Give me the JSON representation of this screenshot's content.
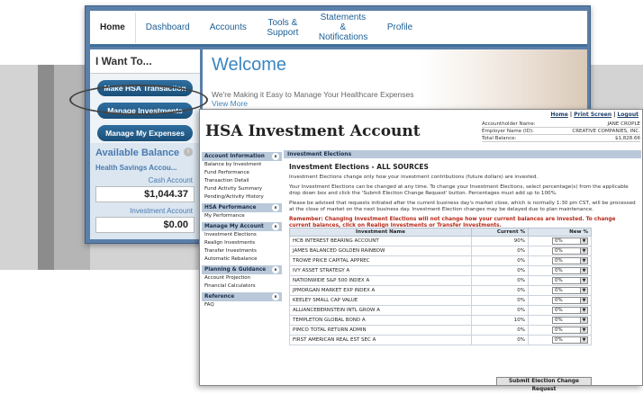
{
  "portal": {
    "nav": [
      "Home",
      "Dashboard",
      "Accounts",
      "Tools & Support",
      "Statements & Notifications",
      "Profile"
    ],
    "iwant": "I Want To...",
    "buttons": [
      "Make HSA Transaction",
      "Manage Investments",
      "Manage My Expenses"
    ],
    "avail_title": "Available Balance",
    "avail_info": "i",
    "acct_name": "Health Savings Accou...",
    "cash_label": "Cash Account",
    "cash_amount": "$1,044.37",
    "inv_label": "Investment Account",
    "inv_amount": "$0.00",
    "welcome": "Welcome",
    "welcome_sub": "We're Making it Easy to Manage Your Healthcare Expenses",
    "view_more": "View More"
  },
  "hsa": {
    "links": [
      "Home",
      "Print Screen",
      "Logout"
    ],
    "title": "HSA Investment Account",
    "holder": [
      {
        "label": "Accountholder Name:",
        "value": "JANE CROPLE"
      },
      {
        "label": "Employer Name (ID):",
        "value": "CREATIVE COMPANIES, INC."
      },
      {
        "label": "Total Balance:",
        "value": "$1,828.66"
      }
    ],
    "sections": [
      {
        "head": "Account Information",
        "items": [
          "Balance by Investment",
          "Fund Performance",
          "Transaction Detail",
          "Fund Activity Summary",
          "Pending/Activity History"
        ]
      },
      {
        "head": "HSA Performance",
        "items": [
          "My Performance"
        ]
      },
      {
        "head": "Manage My Account",
        "items": [
          "Investment Elections",
          "Realign Investments",
          "Transfer Investments",
          "Automatic Rebalance"
        ]
      },
      {
        "head": "Planning & Guidance",
        "items": [
          "Account Projection",
          "Financial Calculators"
        ]
      },
      {
        "head": "Reference",
        "items": [
          "FAQ"
        ]
      }
    ],
    "main_head": "Investment Elections",
    "main_title": "Investment Elections - ALL SOURCES",
    "p1": "Investment Elections change only how your investment contributions (future dollars) are invested.",
    "p2": "Your Investment Elections can be changed at any time. To change your Investment Elections, select percentage(s) from the applicable drop down box and click the 'Submit Election Change Request' button. Percentages must add up to 100%.",
    "p3": "Please be advised that requests initiated after the current business day's market close, which is normally 1:30 pm CST, will be processed at the close of market on the next business day. Investment Election changes may be delayed due to plan maintenance.",
    "warn": "Remember: Changing Investment Elections will not change how your current balances are invested. To change current balances, click on Realign Investments or Transfer Investments.",
    "table_headers": [
      "Investment Name",
      "Current %",
      "New %"
    ],
    "rows": [
      {
        "name": "HCB INTEREST BEARING ACCOUNT",
        "current": "90%",
        "new": "0%"
      },
      {
        "name": "JAMES BALANCED GOLDEN RAINBOW",
        "current": "0%",
        "new": "0%"
      },
      {
        "name": "TROWE PRICE CAPITAL APPREC",
        "current": "0%",
        "new": "0%"
      },
      {
        "name": "IVY ASSET STRATEGY A",
        "current": "0%",
        "new": "0%"
      },
      {
        "name": "NATIONWIDE S&P 500 INDEX A",
        "current": "0%",
        "new": "0%"
      },
      {
        "name": "JPMORGAN MARKET EXP INDEX A",
        "current": "0%",
        "new": "0%"
      },
      {
        "name": "KEELEY SMALL CAP VALUE",
        "current": "0%",
        "new": "0%"
      },
      {
        "name": "ALLIANCEBERNSTEIN INTL GROW A",
        "current": "0%",
        "new": "0%"
      },
      {
        "name": "TEMPLETON GLOBAL BOND A",
        "current": "10%",
        "new": "0%"
      },
      {
        "name": "PIMCO TOTAL RETURN ADMIN",
        "current": "0%",
        "new": "0%"
      },
      {
        "name": "FIRST AMERICAN REAL EST SEC A",
        "current": "0%",
        "new": "0%"
      }
    ],
    "submit": "Submit Election Change Request"
  }
}
